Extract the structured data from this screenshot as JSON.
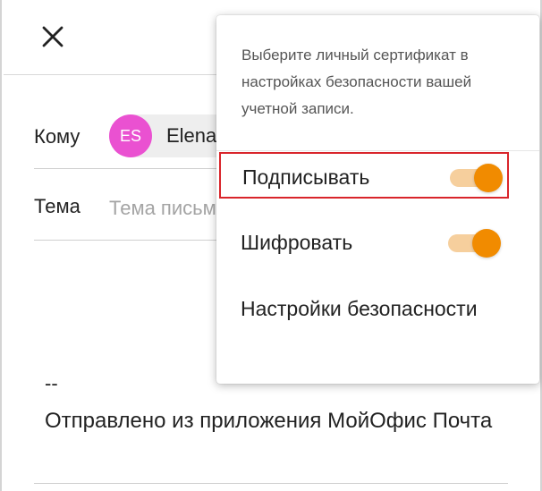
{
  "compose": {
    "to_label": "Кому",
    "recipient": {
      "initials": "ES",
      "name": "Elena",
      "avatar_color": "#ea51d1"
    },
    "subject_label": "Тема",
    "subject_placeholder": "Тема письма",
    "subject_value": "",
    "signature_dash": "--",
    "signature_text": "Отправлено из приложения МойОфис Почта"
  },
  "security_menu": {
    "info_text": "Выберите личный сертификат в настройках безопасности вашей учетной записи.",
    "items": [
      {
        "label": "Подписывать",
        "toggle_on": true,
        "highlighted": true
      },
      {
        "label": "Шифровать",
        "toggle_on": true,
        "highlighted": false
      }
    ],
    "settings_label": "Настройки безопасности",
    "accent_color": "#f18b00",
    "highlight_color": "#d9252b"
  },
  "icons": {
    "close": "close-icon"
  }
}
